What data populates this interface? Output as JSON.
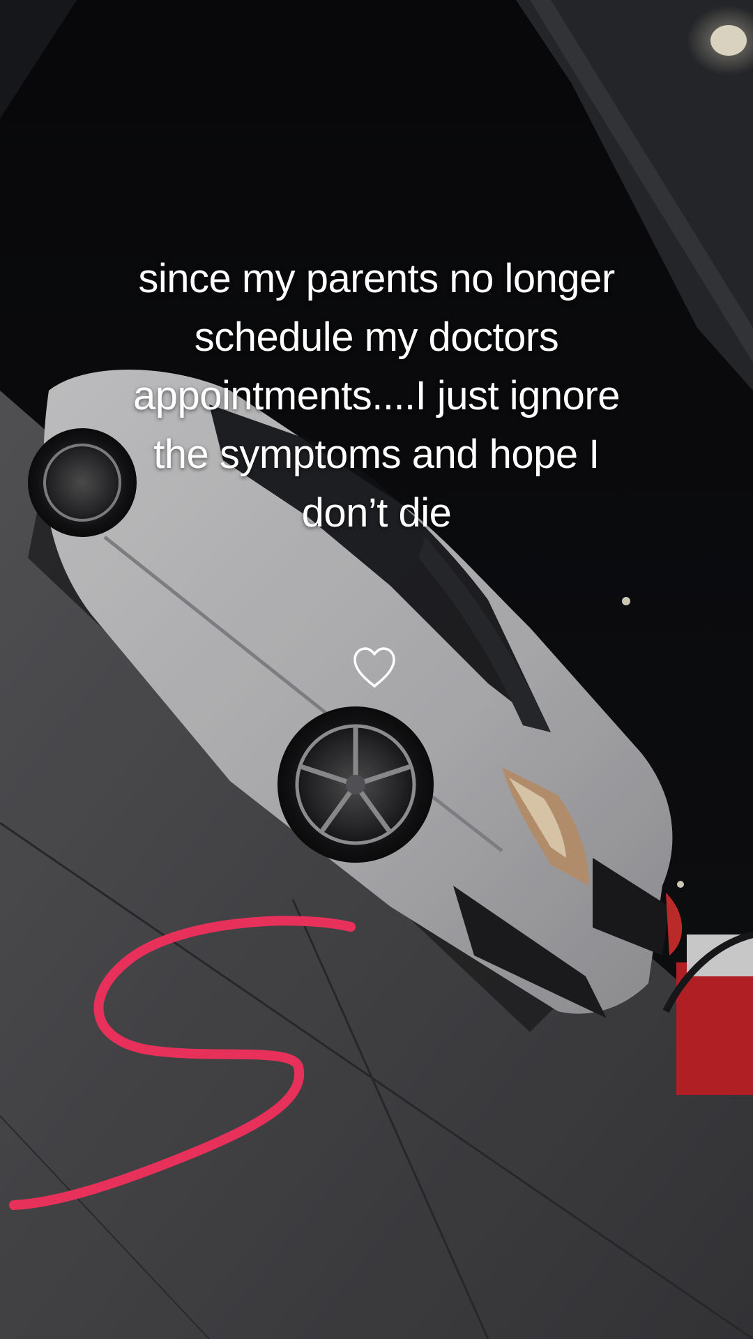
{
  "story": {
    "caption": "since my parents no longer\nschedule my doctors\nappointments....I just ignore\nthe symptoms and hope I\ndon’t die",
    "like_icon": "heart-outline-icon",
    "scribble_icon": "pink-s-scribble",
    "scribble_color": "#e8315a",
    "caption_color": "#ffffff"
  }
}
